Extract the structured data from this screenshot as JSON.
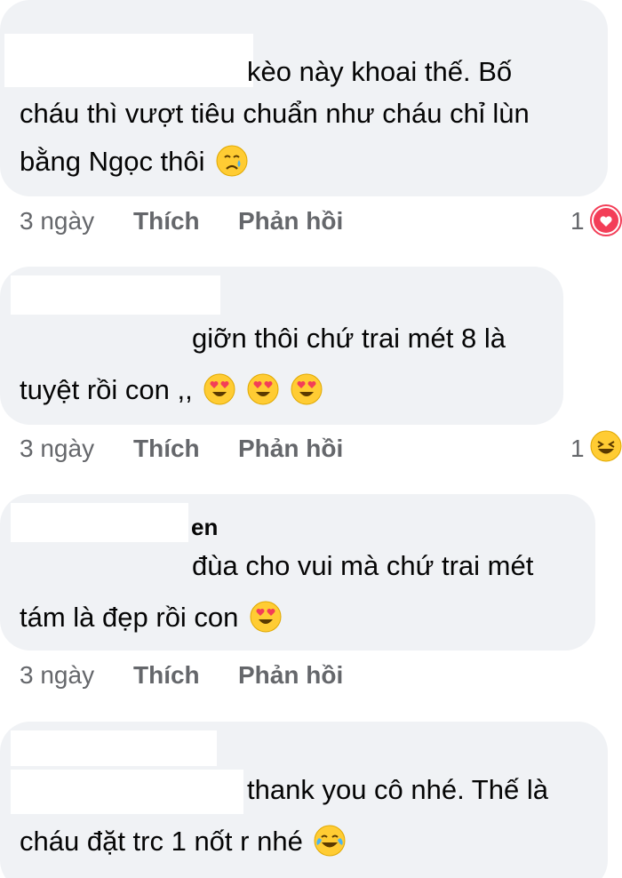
{
  "comments": [
    {
      "author": "",
      "lines": [
        "kèo này khoai thế. Bố",
        "cháu thì vượt tiêu chuẩn như cháu chỉ lùn",
        "bằng Ngọc thôi"
      ],
      "emoji": [
        "crying-face"
      ],
      "time": "3 ngày",
      "like_label": "Thích",
      "reply_label": "Phản hồi",
      "reaction_count": "1",
      "reaction": "heart"
    },
    {
      "author": "",
      "lines": [
        "giỡn thôi chứ trai mét 8 là",
        "tuyệt rồi con ,,"
      ],
      "emoji": [
        "heart-eyes",
        "heart-eyes",
        "heart-eyes"
      ],
      "time": "3 ngày",
      "like_label": "Thích",
      "reply_label": "Phản hồi",
      "reaction_count": "1",
      "reaction": "laughing"
    },
    {
      "author": "en",
      "lines": [
        "đùa cho vui mà chứ trai mét",
        "tám là đẹp rồi con"
      ],
      "emoji": [
        "heart-eyes"
      ],
      "time": "3 ngày",
      "like_label": "Thích",
      "reply_label": "Phản hồi"
    },
    {
      "author": "",
      "lines": [
        "thank you cô nhé. Thế là",
        "cháu đặt trc 1 nốt r nhé"
      ],
      "emoji": [
        "tears-of-joy"
      ]
    }
  ],
  "colors": {
    "bubble": "#f0f2f5",
    "meta_text": "#65676b",
    "heart": "#f33e58",
    "emoji_yellow": "#ffcc33"
  }
}
